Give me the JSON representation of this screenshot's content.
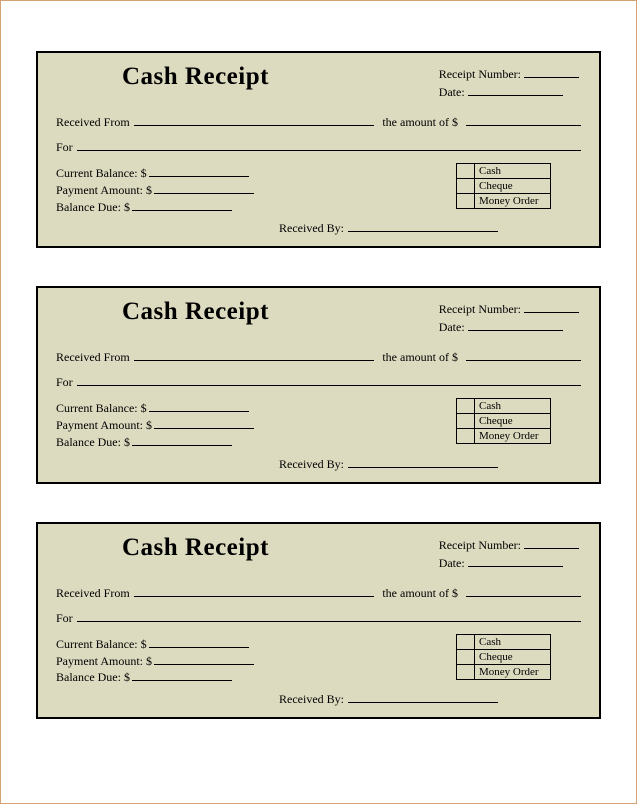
{
  "receipt": {
    "title": "Cash Receipt",
    "receipt_number_label": "Receipt Number:",
    "date_label": "Date:",
    "received_from_label": "Received From",
    "amount_label": "the amount of $",
    "for_label": "For",
    "current_balance_label": "Current Balance: $",
    "payment_amount_label": "Payment Amount: $",
    "balance_due_label": "Balance Due: $",
    "received_by_label": "Received By:",
    "payment_methods": [
      "Cash",
      "Cheque",
      "Money Order"
    ]
  }
}
